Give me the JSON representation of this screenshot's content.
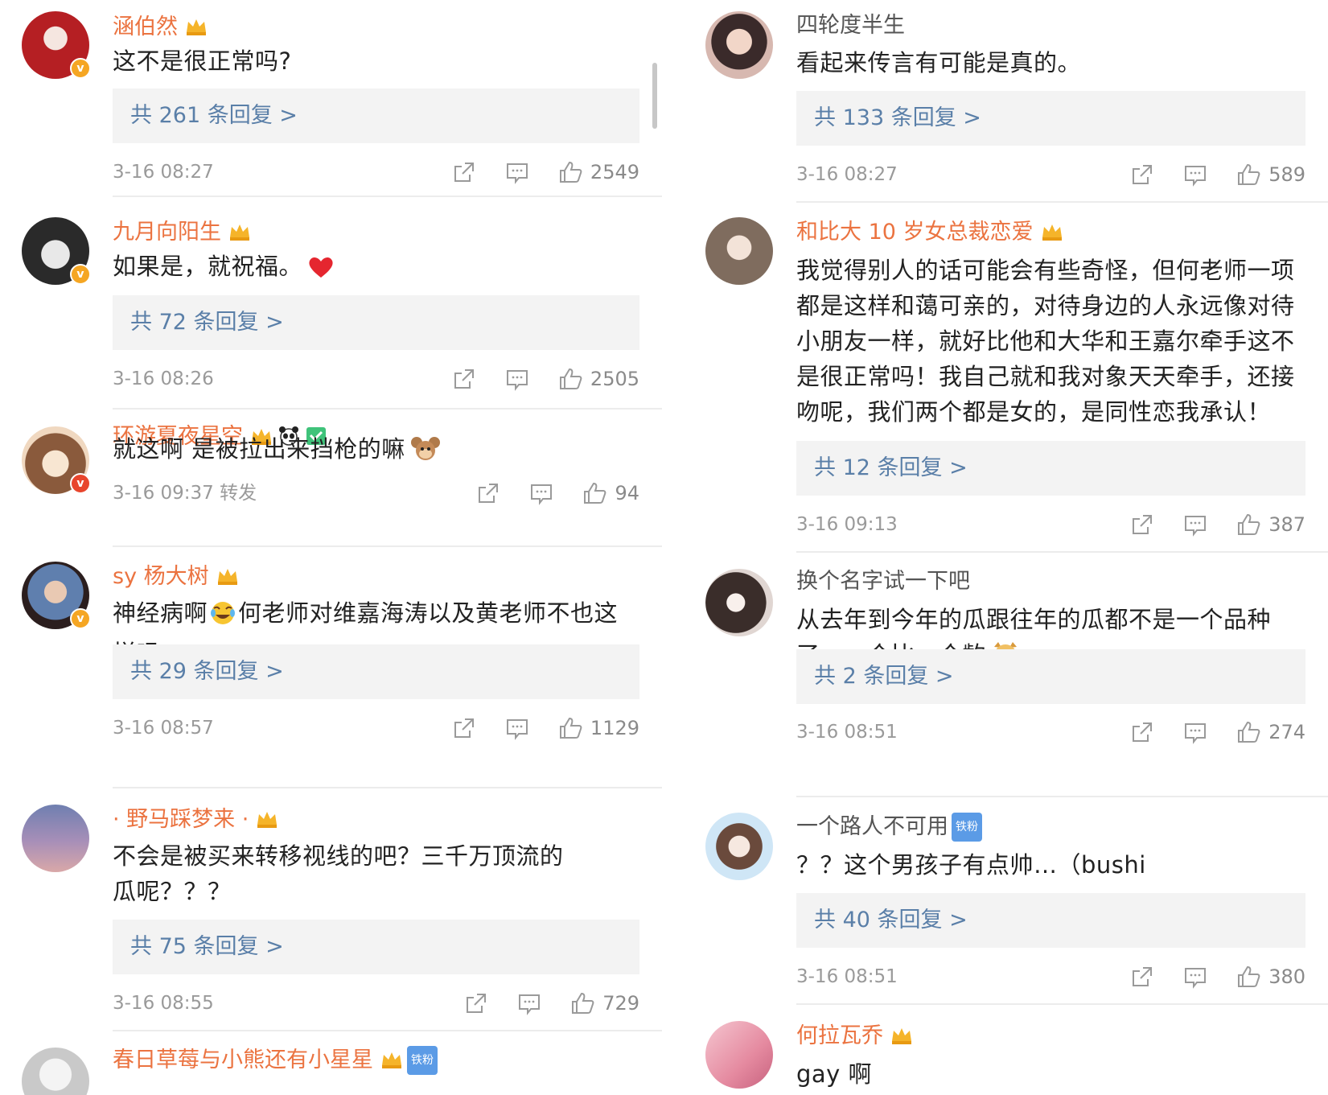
{
  "left_column": [
    {
      "username": "涵伯然",
      "user_style": "vip",
      "has_crown": true,
      "badge": "gold",
      "text": "这不是很正常吗?",
      "replies": "共 261 条回复 >",
      "time": "3-16 08:27",
      "likes": "2549"
    },
    {
      "username": "九月向阳生",
      "user_style": "vip",
      "has_crown": true,
      "badge": "gold",
      "text": "如果是，就祝福。",
      "text_emoji": "heart",
      "replies": "共 72 条回复 >",
      "time": "3-16 08:26",
      "likes": "2505"
    },
    {
      "username": "环游夏夜星空",
      "user_style": "vip",
      "has_crown": true,
      "extra_icons": [
        "panda",
        "green-badge"
      ],
      "badge": "red",
      "text": "就这啊 是被拉出来挡枪的嘛",
      "text_emoji": "mouse-face",
      "time": "3-16 09:37  转发",
      "likes": "94"
    },
    {
      "username": "sy 杨大树",
      "user_style": "vip",
      "has_crown": true,
      "badge": "gold",
      "text_parts": [
        "神经病啊",
        "何老师对维嘉海涛以及黄老师不也这样吗"
      ],
      "text_emoji": "laugh-cry",
      "replies": "共 29 条回复 >",
      "time": "3-16 08:57",
      "likes": "1129"
    },
    {
      "username": "· 野马踩梦来 ·",
      "user_style": "vip",
      "has_crown": true,
      "text": "不会是被买来转移视线的吧？三千万顶流的瓜呢？？？",
      "replies": "共 75 条回复 >",
      "time": "3-16 08:55",
      "likes": "729"
    },
    {
      "username": "春日草莓与小熊还有小星星",
      "user_style": "vip",
      "has_crown": true,
      "tag": "铁粉"
    }
  ],
  "right_column": [
    {
      "username": "四轮度半生",
      "user_style": "plain",
      "text": "看起来传言有可能是真的。",
      "replies": "共 133 条回复 >",
      "time": "3-16 08:27",
      "likes": "589"
    },
    {
      "username": "和比大 10 岁女总裁恋爱",
      "user_style": "vip",
      "has_crown": true,
      "text": "我觉得别人的话可能会有些奇怪，但何老师一项都是这样和蔼可亲的，对待身边的人永远像对待小朋友一样，就好比他和大华和王嘉尔牵手这不是很正常吗！我自己就和我对象天天牵手，还接吻呢，我们两个都是女的，是同性恋我承认！",
      "replies": "共 12 条回复 >",
      "time": "3-16 09:13",
      "likes": "387"
    },
    {
      "username": "换个名字试一下吧",
      "user_style": "plain",
      "text": "从去年到今年的瓜跟往年的瓜都不是一个品种了，一个比一个齣",
      "text_emoji": "doge",
      "replies": "共 2 条回复 >",
      "time": "3-16 08:51",
      "likes": "274"
    },
    {
      "username": "一个路人不可用",
      "user_style": "plain",
      "tag": "铁粉",
      "text": "？？这个男孩子有点帅…（bushi",
      "replies": "共 40 条回复 >",
      "time": "3-16 08:51",
      "likes": "380"
    },
    {
      "username": "何拉瓦乔",
      "user_style": "vip",
      "has_crown": true,
      "text": "gay 啊"
    }
  ],
  "colors": {
    "vip_name": "#eb7340",
    "reply_link": "#5a7fa8",
    "reply_bg": "#f3f3f3",
    "meta": "#9a9a9a",
    "divider": "#ececec"
  }
}
